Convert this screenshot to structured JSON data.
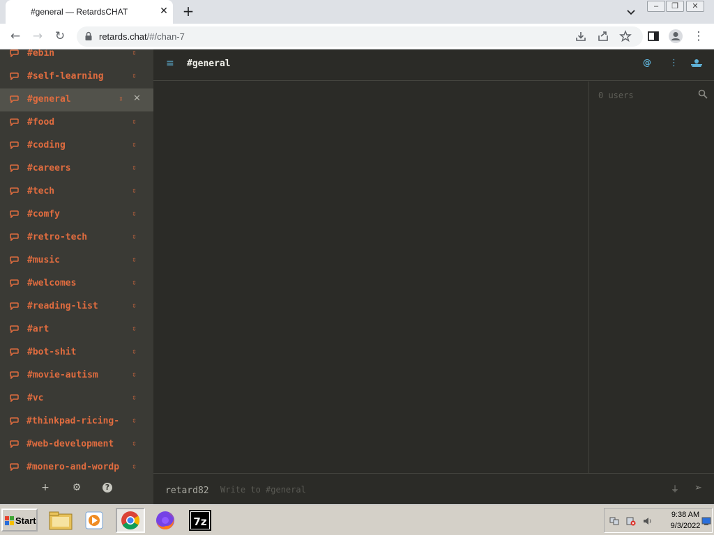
{
  "browser": {
    "tab_title": "#general — RetardsCHAT",
    "tab_close": "✕",
    "new_tab": "+",
    "url_host": "retards.chat",
    "url_path": "/#/chan-7",
    "window_buttons": [
      "–",
      "❐",
      "✕"
    ]
  },
  "sidebar": {
    "channels": [
      {
        "name": "#ebin",
        "badge": "⇳",
        "active": false
      },
      {
        "name": "#self-learning",
        "badge": "⇳",
        "active": false
      },
      {
        "name": "#general",
        "badge": "⇳",
        "close": "✕",
        "active": true
      },
      {
        "name": "#food",
        "badge": "⇳",
        "active": false
      },
      {
        "name": "#coding",
        "badge": "⇳",
        "active": false
      },
      {
        "name": "#careers",
        "badge": "⇳",
        "active": false
      },
      {
        "name": "#tech",
        "badge": "⇳",
        "active": false
      },
      {
        "name": "#comfy",
        "badge": "⇳",
        "active": false
      },
      {
        "name": "#retro-tech",
        "badge": "⇳",
        "active": false
      },
      {
        "name": "#music",
        "badge": "⇳",
        "active": false
      },
      {
        "name": "#welcomes",
        "badge": "⇳",
        "active": false
      },
      {
        "name": "#reading-list",
        "badge": "⇳",
        "active": false
      },
      {
        "name": "#art",
        "badge": "⇳",
        "active": false
      },
      {
        "name": "#bot-shit",
        "badge": "⇳",
        "active": false
      },
      {
        "name": "#movie-autism",
        "badge": "⇳",
        "active": false
      },
      {
        "name": "#vc",
        "badge": "⇳",
        "active": false
      },
      {
        "name": "#thinkpad-ricing-",
        "badge": "⇳",
        "active": false
      },
      {
        "name": "#web-development",
        "badge": "⇳",
        "active": false
      },
      {
        "name": "#monero-and-wordp",
        "badge": "⇳",
        "active": false
      }
    ],
    "footer": {
      "add": "+",
      "settings": "⚙",
      "help": "?"
    }
  },
  "header": {
    "menu_icon": "≡",
    "title": "#general",
    "mention_icon": "@",
    "more_icon": "⋮"
  },
  "userlist": {
    "count_text": "0 users"
  },
  "composer": {
    "nick": "retard82",
    "placeholder": "Write to #general",
    "attach_icon": "📎",
    "send_icon": "➢"
  },
  "taskbar": {
    "start_label": "Start",
    "time": "9:38 AM",
    "date": "9/3/2022"
  },
  "colors": {
    "channel_text": "#e06c3f",
    "accent": "#5fb3d9",
    "sidebar_bg": "#3a3a35",
    "main_bg": "#2b2b27"
  }
}
